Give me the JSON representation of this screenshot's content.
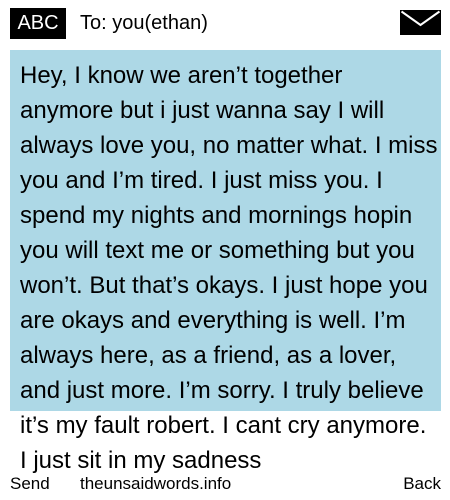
{
  "header": {
    "input_mode": "ABC",
    "to_label": "To: you(ethan)",
    "icon": "envelope-icon"
  },
  "message": {
    "body": "Hey, I know we aren’t  together anymore but i just wanna say I will always love you, no matter what. I miss you and I’m tired. I just miss you. I spend my nights and mornings hopin you will text me or something but you won’t. But that’s okays. I just hope you are okays and everything is well. I’m always here, as a friend, as a lover, and just more. I’m sorry. I truly believe it’s my fault robert. I cant cry anymore. I just sit in my sadness"
  },
  "softkeys": {
    "left": "Send",
    "center": "theunsaidwords.info",
    "right": "Back"
  },
  "colors": {
    "message_background": "#add8e6",
    "mode_badge": "#000000"
  }
}
